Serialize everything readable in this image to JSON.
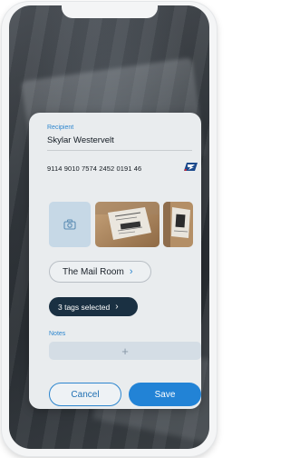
{
  "recipient": {
    "label": "Recipient",
    "name": "Skylar Westervelt"
  },
  "tracking": {
    "number": "9114 9010 7574 2452 0191 46",
    "carrier_icon": "usps-eagle-icon"
  },
  "photos": {
    "add_icon": "camera-icon"
  },
  "location": {
    "label": "The Mail Room",
    "chevron": "›"
  },
  "tags": {
    "label": "3 tags selected",
    "chevron": "›"
  },
  "notes": {
    "label": "Notes",
    "add_icon": "+"
  },
  "actions": {
    "cancel_label": "Cancel",
    "save_label": "Save"
  },
  "colors": {
    "accent": "#2283d6",
    "dark": "#1a3042",
    "card": "#e9ecee"
  }
}
